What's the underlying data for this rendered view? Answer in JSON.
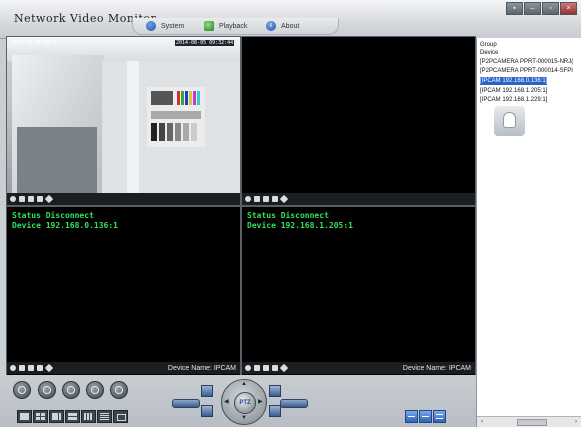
{
  "app": {
    "title": "Network Video Monitor"
  },
  "menu": {
    "system": "System",
    "playback": "Playback",
    "about": "About"
  },
  "window_buttons": [
    "▪",
    "–",
    "▫",
    "×"
  ],
  "panes": [
    {
      "id": "cam1",
      "timestamp_left": "2014-08-05 09:2",
      "timestamp_right": "2014-08-05 09:32:44",
      "device_name": ""
    },
    {
      "id": "empty",
      "device_name": ""
    },
    {
      "id": "cam3",
      "status": "Status Disconnect",
      "device": "Device 192.168.0.136:1",
      "device_name": "Device Name: IPCAM"
    },
    {
      "id": "cam4",
      "status": "Status Disconnect",
      "device": "Device 192.168.1.205:1",
      "device_name": "Device Name: IPCAM"
    }
  ],
  "sidebar": {
    "group_label": "Group",
    "device_label": "Device",
    "devices": [
      "[P2PCAMERA PPRT-000015-NRJ(",
      "[P2PCAMERA PPRT-000014-SFPI",
      "[IPCAM 192.168.0.136:1]",
      "[IPCAM 192.168.1.205:1]",
      "[IPCAM 192.168.1.229:1]"
    ],
    "selected_index": 2,
    "scroll_left": "‹",
    "scroll_right": "›"
  },
  "ptz": {
    "label": "PTZ"
  },
  "colors": {
    "status_text": "#32e05a",
    "selection": "#2a62c8"
  }
}
